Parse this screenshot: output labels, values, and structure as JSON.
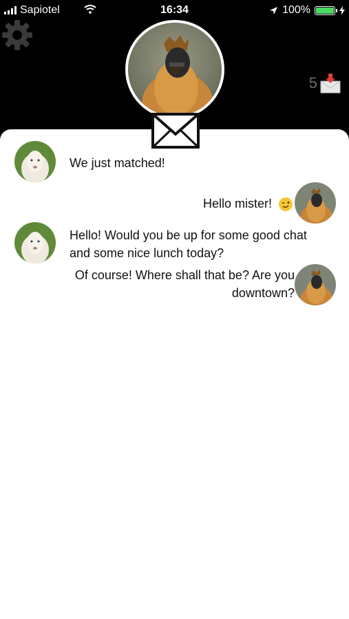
{
  "status": {
    "carrier": "Sapiotel",
    "time": "16:34",
    "battery": "100%"
  },
  "header": {
    "unread_count": "5"
  },
  "messages": [
    {
      "side": "left",
      "text": "We just matched!"
    },
    {
      "side": "right",
      "text": "Hello mister!"
    },
    {
      "side": "left",
      "line1": "Hello! Would you be up for some good chat",
      "line2": "and some nice lunch today?"
    },
    {
      "side": "right",
      "line1": "Of course! Where shall that be? Are you",
      "line2": "downtown?"
    }
  ],
  "icons": {
    "settings": "gear-icon",
    "inbox": "inbox-download-icon",
    "envelope": "envelope-icon",
    "emoji": "wink-emoji"
  },
  "colors": {
    "header_bg": "#000000",
    "chat_bg": "#ffffff",
    "battery": "#4cd964"
  }
}
